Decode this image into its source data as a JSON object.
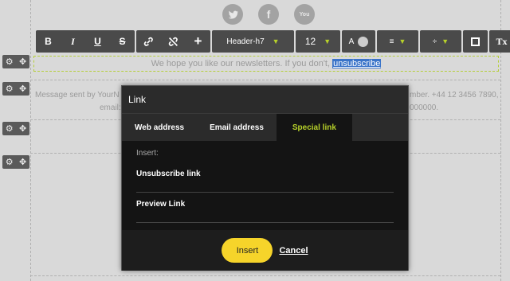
{
  "social": {
    "twitter_icon": "twitter-icon",
    "facebook_label": "f",
    "youtube_label": "You"
  },
  "toolbar": {
    "bold": "B",
    "italic": "I",
    "underline": "U",
    "strike": "S",
    "add": "+",
    "style_select": "Header-h7",
    "size_select": "12",
    "color_label": "A",
    "clear_format": "Tx"
  },
  "content": {
    "newsletter_text": "We hope you like our newsletters. If you don't,",
    "selected_link": "unsubscribe",
    "footer_left": "Message sent by YourN",
    "footer_right": "mber. +44 12 3456 7890,",
    "footer_left2": "email:",
    "footer_right2": "000000."
  },
  "modal": {
    "title": "Link",
    "tabs": [
      "Web address",
      "Email address",
      "Special link"
    ],
    "active_tab": "Special link",
    "insert_label": "Insert:",
    "items": [
      "Unsubscribe link",
      "Preview Link"
    ],
    "insert_button": "Insert",
    "cancel_button": "Cancel"
  },
  "colors": {
    "accent": "#b7d12a",
    "insert": "#f6d42a",
    "selection": "#3a74c9"
  }
}
